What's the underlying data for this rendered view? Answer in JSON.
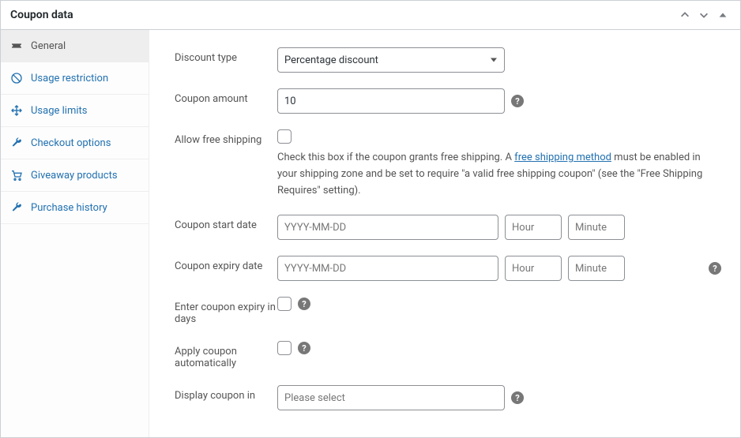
{
  "panel_title": "Coupon data",
  "sidebar": {
    "items": [
      {
        "label": "General"
      },
      {
        "label": "Usage restriction"
      },
      {
        "label": "Usage limits"
      },
      {
        "label": "Checkout options"
      },
      {
        "label": "Giveaway products"
      },
      {
        "label": "Purchase history"
      }
    ]
  },
  "form": {
    "discount_type": {
      "label": "Discount type",
      "value": "Percentage discount"
    },
    "coupon_amount": {
      "label": "Coupon amount",
      "value": "10"
    },
    "free_shipping": {
      "label": "Allow free shipping",
      "desc_pre": "Check this box if the coupon grants free shipping. A ",
      "link_text": "free shipping method",
      "desc_post": " must be enabled in your shipping zone and be set to require \"a valid free shipping coupon\" (see the \"Free Shipping Requires\" setting)."
    },
    "start_date": {
      "label": "Coupon start date",
      "date_ph": "YYYY-MM-DD",
      "hour_ph": "Hour",
      "minute_ph": "Minute"
    },
    "expiry_date": {
      "label": "Coupon expiry date",
      "date_ph": "YYYY-MM-DD",
      "hour_ph": "Hour",
      "minute_ph": "Minute"
    },
    "expiry_days": {
      "label": "Enter coupon expiry in days"
    },
    "auto_apply": {
      "label": "Apply coupon automatically"
    },
    "display_in": {
      "label": "Display coupon in",
      "placeholder": "Please select"
    }
  }
}
